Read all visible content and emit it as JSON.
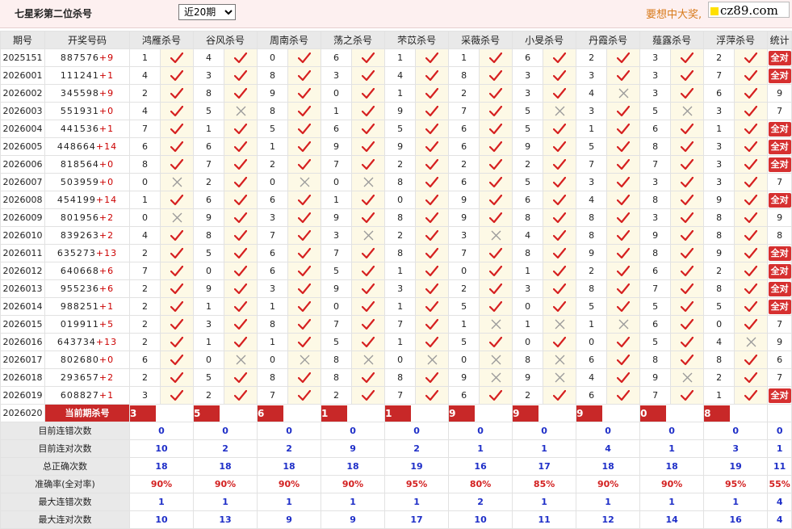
{
  "header": {
    "title": "七星彩第二位杀号",
    "select_value": "近20期",
    "select_options": [
      "近20期"
    ],
    "slogan": "要想中大奖,",
    "logo": "cz89.com"
  },
  "columns": {
    "issue": "期号",
    "draw": "开奖号码",
    "stat": "统计",
    "experts": [
      "鸿雁杀号",
      "谷风杀号",
      "周南杀号",
      "荡之杀号",
      "芣苡杀号",
      "采薇杀号",
      "小旻杀号",
      "丹霞杀号",
      "薤露杀号",
      "浮萍杀号"
    ]
  },
  "rows": [
    {
      "issue": "2025151",
      "digits": "887576",
      "key": "+9",
      "kills": [
        "1",
        "4",
        "0",
        "6",
        "1",
        "1",
        "6",
        "2",
        "3",
        "2"
      ],
      "marks": "1111111111",
      "stat": "全对"
    },
    {
      "issue": "2026001",
      "digits": "111241",
      "key": "+1",
      "kills": [
        "4",
        "3",
        "8",
        "3",
        "4",
        "8",
        "3",
        "3",
        "3",
        "7"
      ],
      "marks": "1111111111",
      "stat": "全对"
    },
    {
      "issue": "2026002",
      "digits": "345598",
      "key": "+9",
      "kills": [
        "2",
        "8",
        "9",
        "0",
        "1",
        "2",
        "3",
        "4",
        "3",
        "6"
      ],
      "marks": "1111111011",
      "stat": "9"
    },
    {
      "issue": "2026003",
      "digits": "551931",
      "key": "+0",
      "kills": [
        "4",
        "5",
        "8",
        "1",
        "9",
        "7",
        "5",
        "3",
        "5",
        "3"
      ],
      "marks": "1011110101",
      "stat": "7"
    },
    {
      "issue": "2026004",
      "digits": "441536",
      "key": "+1",
      "kills": [
        "7",
        "1",
        "5",
        "6",
        "5",
        "6",
        "5",
        "1",
        "6",
        "1"
      ],
      "marks": "1111111111",
      "stat": "全对"
    },
    {
      "issue": "2026005",
      "digits": "448664",
      "key": "+14",
      "kills": [
        "6",
        "6",
        "1",
        "9",
        "9",
        "6",
        "9",
        "5",
        "8",
        "3"
      ],
      "marks": "1111111111",
      "stat": "全对"
    },
    {
      "issue": "2026006",
      "digits": "818564",
      "key": "+0",
      "kills": [
        "8",
        "7",
        "2",
        "7",
        "2",
        "2",
        "2",
        "7",
        "7",
        "3"
      ],
      "marks": "1111111111",
      "stat": "全对"
    },
    {
      "issue": "2026007",
      "digits": "503959",
      "key": "+0",
      "kills": [
        "0",
        "2",
        "0",
        "0",
        "8",
        "6",
        "5",
        "3",
        "3",
        "3"
      ],
      "marks": "0100111111",
      "stat": "7"
    },
    {
      "issue": "2026008",
      "digits": "454199",
      "key": "+14",
      "kills": [
        "1",
        "6",
        "6",
        "1",
        "0",
        "9",
        "6",
        "4",
        "8",
        "9"
      ],
      "marks": "1111111111",
      "stat": "全对"
    },
    {
      "issue": "2026009",
      "digits": "801956",
      "key": "+2",
      "kills": [
        "0",
        "9",
        "3",
        "9",
        "8",
        "9",
        "8",
        "8",
        "3",
        "8"
      ],
      "marks": "0111111111",
      "stat": "9"
    },
    {
      "issue": "2026010",
      "digits": "839263",
      "key": "+2",
      "kills": [
        "4",
        "8",
        "7",
        "3",
        "2",
        "3",
        "4",
        "8",
        "9",
        "8"
      ],
      "marks": "1110101111",
      "stat": "8"
    },
    {
      "issue": "2026011",
      "digits": "635273",
      "key": "+13",
      "kills": [
        "2",
        "5",
        "6",
        "7",
        "8",
        "7",
        "8",
        "9",
        "8",
        "9"
      ],
      "marks": "1111111111",
      "stat": "全对"
    },
    {
      "issue": "2026012",
      "digits": "640668",
      "key": "+6",
      "kills": [
        "7",
        "0",
        "6",
        "5",
        "1",
        "0",
        "1",
        "2",
        "6",
        "2"
      ],
      "marks": "1111111111",
      "stat": "全对"
    },
    {
      "issue": "2026013",
      "digits": "955236",
      "key": "+6",
      "kills": [
        "2",
        "9",
        "3",
        "9",
        "3",
        "2",
        "3",
        "8",
        "7",
        "8"
      ],
      "marks": "1111111111",
      "stat": "全对"
    },
    {
      "issue": "2026014",
      "digits": "988251",
      "key": "+1",
      "kills": [
        "2",
        "1",
        "1",
        "0",
        "1",
        "5",
        "0",
        "5",
        "5",
        "5"
      ],
      "marks": "1111111111",
      "stat": "全对"
    },
    {
      "issue": "2026015",
      "digits": "019911",
      "key": "+5",
      "kills": [
        "2",
        "3",
        "8",
        "7",
        "7",
        "1",
        "1",
        "1",
        "6",
        "0"
      ],
      "marks": "1111100011",
      "stat": "7"
    },
    {
      "issue": "2026016",
      "digits": "643734",
      "key": "+13",
      "kills": [
        "2",
        "1",
        "1",
        "5",
        "1",
        "5",
        "0",
        "0",
        "5",
        "4"
      ],
      "marks": "1111111110",
      "stat": "9"
    },
    {
      "issue": "2026017",
      "digits": "802680",
      "key": "+0",
      "kills": [
        "6",
        "0",
        "0",
        "8",
        "0",
        "0",
        "8",
        "6",
        "8",
        "8"
      ],
      "marks": "1000000111",
      "stat": "6"
    },
    {
      "issue": "2026018",
      "digits": "293657",
      "key": "+2",
      "kills": [
        "2",
        "5",
        "8",
        "8",
        "8",
        "9",
        "9",
        "4",
        "9",
        "2"
      ],
      "marks": "1111100101",
      "stat": "7"
    },
    {
      "issue": "2026019",
      "digits": "608827",
      "key": "+1",
      "kills": [
        "3",
        "2",
        "7",
        "2",
        "7",
        "6",
        "2",
        "6",
        "7",
        "1"
      ],
      "marks": "1111111111",
      "stat": "全对"
    }
  ],
  "current": {
    "issue": "2026020",
    "label": "当前期杀号",
    "kills": [
      "3",
      "5",
      "6",
      "1",
      "1",
      "9",
      "9",
      "9",
      "0",
      "8"
    ]
  },
  "summary": [
    {
      "label": "目前连错次数",
      "values": [
        "0",
        "0",
        "0",
        "0",
        "0",
        "0",
        "0",
        "0",
        "0",
        "0"
      ],
      "stat": "0",
      "color": "blue"
    },
    {
      "label": "目前连对次数",
      "values": [
        "10",
        "2",
        "2",
        "9",
        "2",
        "1",
        "1",
        "4",
        "1",
        "3"
      ],
      "stat": "1",
      "color": "blue"
    },
    {
      "label": "总正确次数",
      "values": [
        "18",
        "18",
        "18",
        "18",
        "19",
        "16",
        "17",
        "18",
        "18",
        "19"
      ],
      "stat": "11",
      "color": "blue"
    },
    {
      "label": "准确率(全对率)",
      "values": [
        "90%",
        "90%",
        "90%",
        "90%",
        "95%",
        "80%",
        "85%",
        "90%",
        "90%",
        "95%"
      ],
      "stat": "55%",
      "color": "red"
    },
    {
      "label": "最大连错次数",
      "values": [
        "1",
        "1",
        "1",
        "1",
        "1",
        "2",
        "1",
        "1",
        "1",
        "1"
      ],
      "stat": "4",
      "color": "blue"
    },
    {
      "label": "最大连对次数",
      "values": [
        "10",
        "13",
        "9",
        "9",
        "17",
        "10",
        "11",
        "12",
        "14",
        "16"
      ],
      "stat": "4",
      "color": "blue"
    }
  ],
  "colors": {
    "check": "#d62020",
    "cross": "#9a9a9a",
    "accent": "#c82828",
    "blue": "#1f2fc8"
  }
}
